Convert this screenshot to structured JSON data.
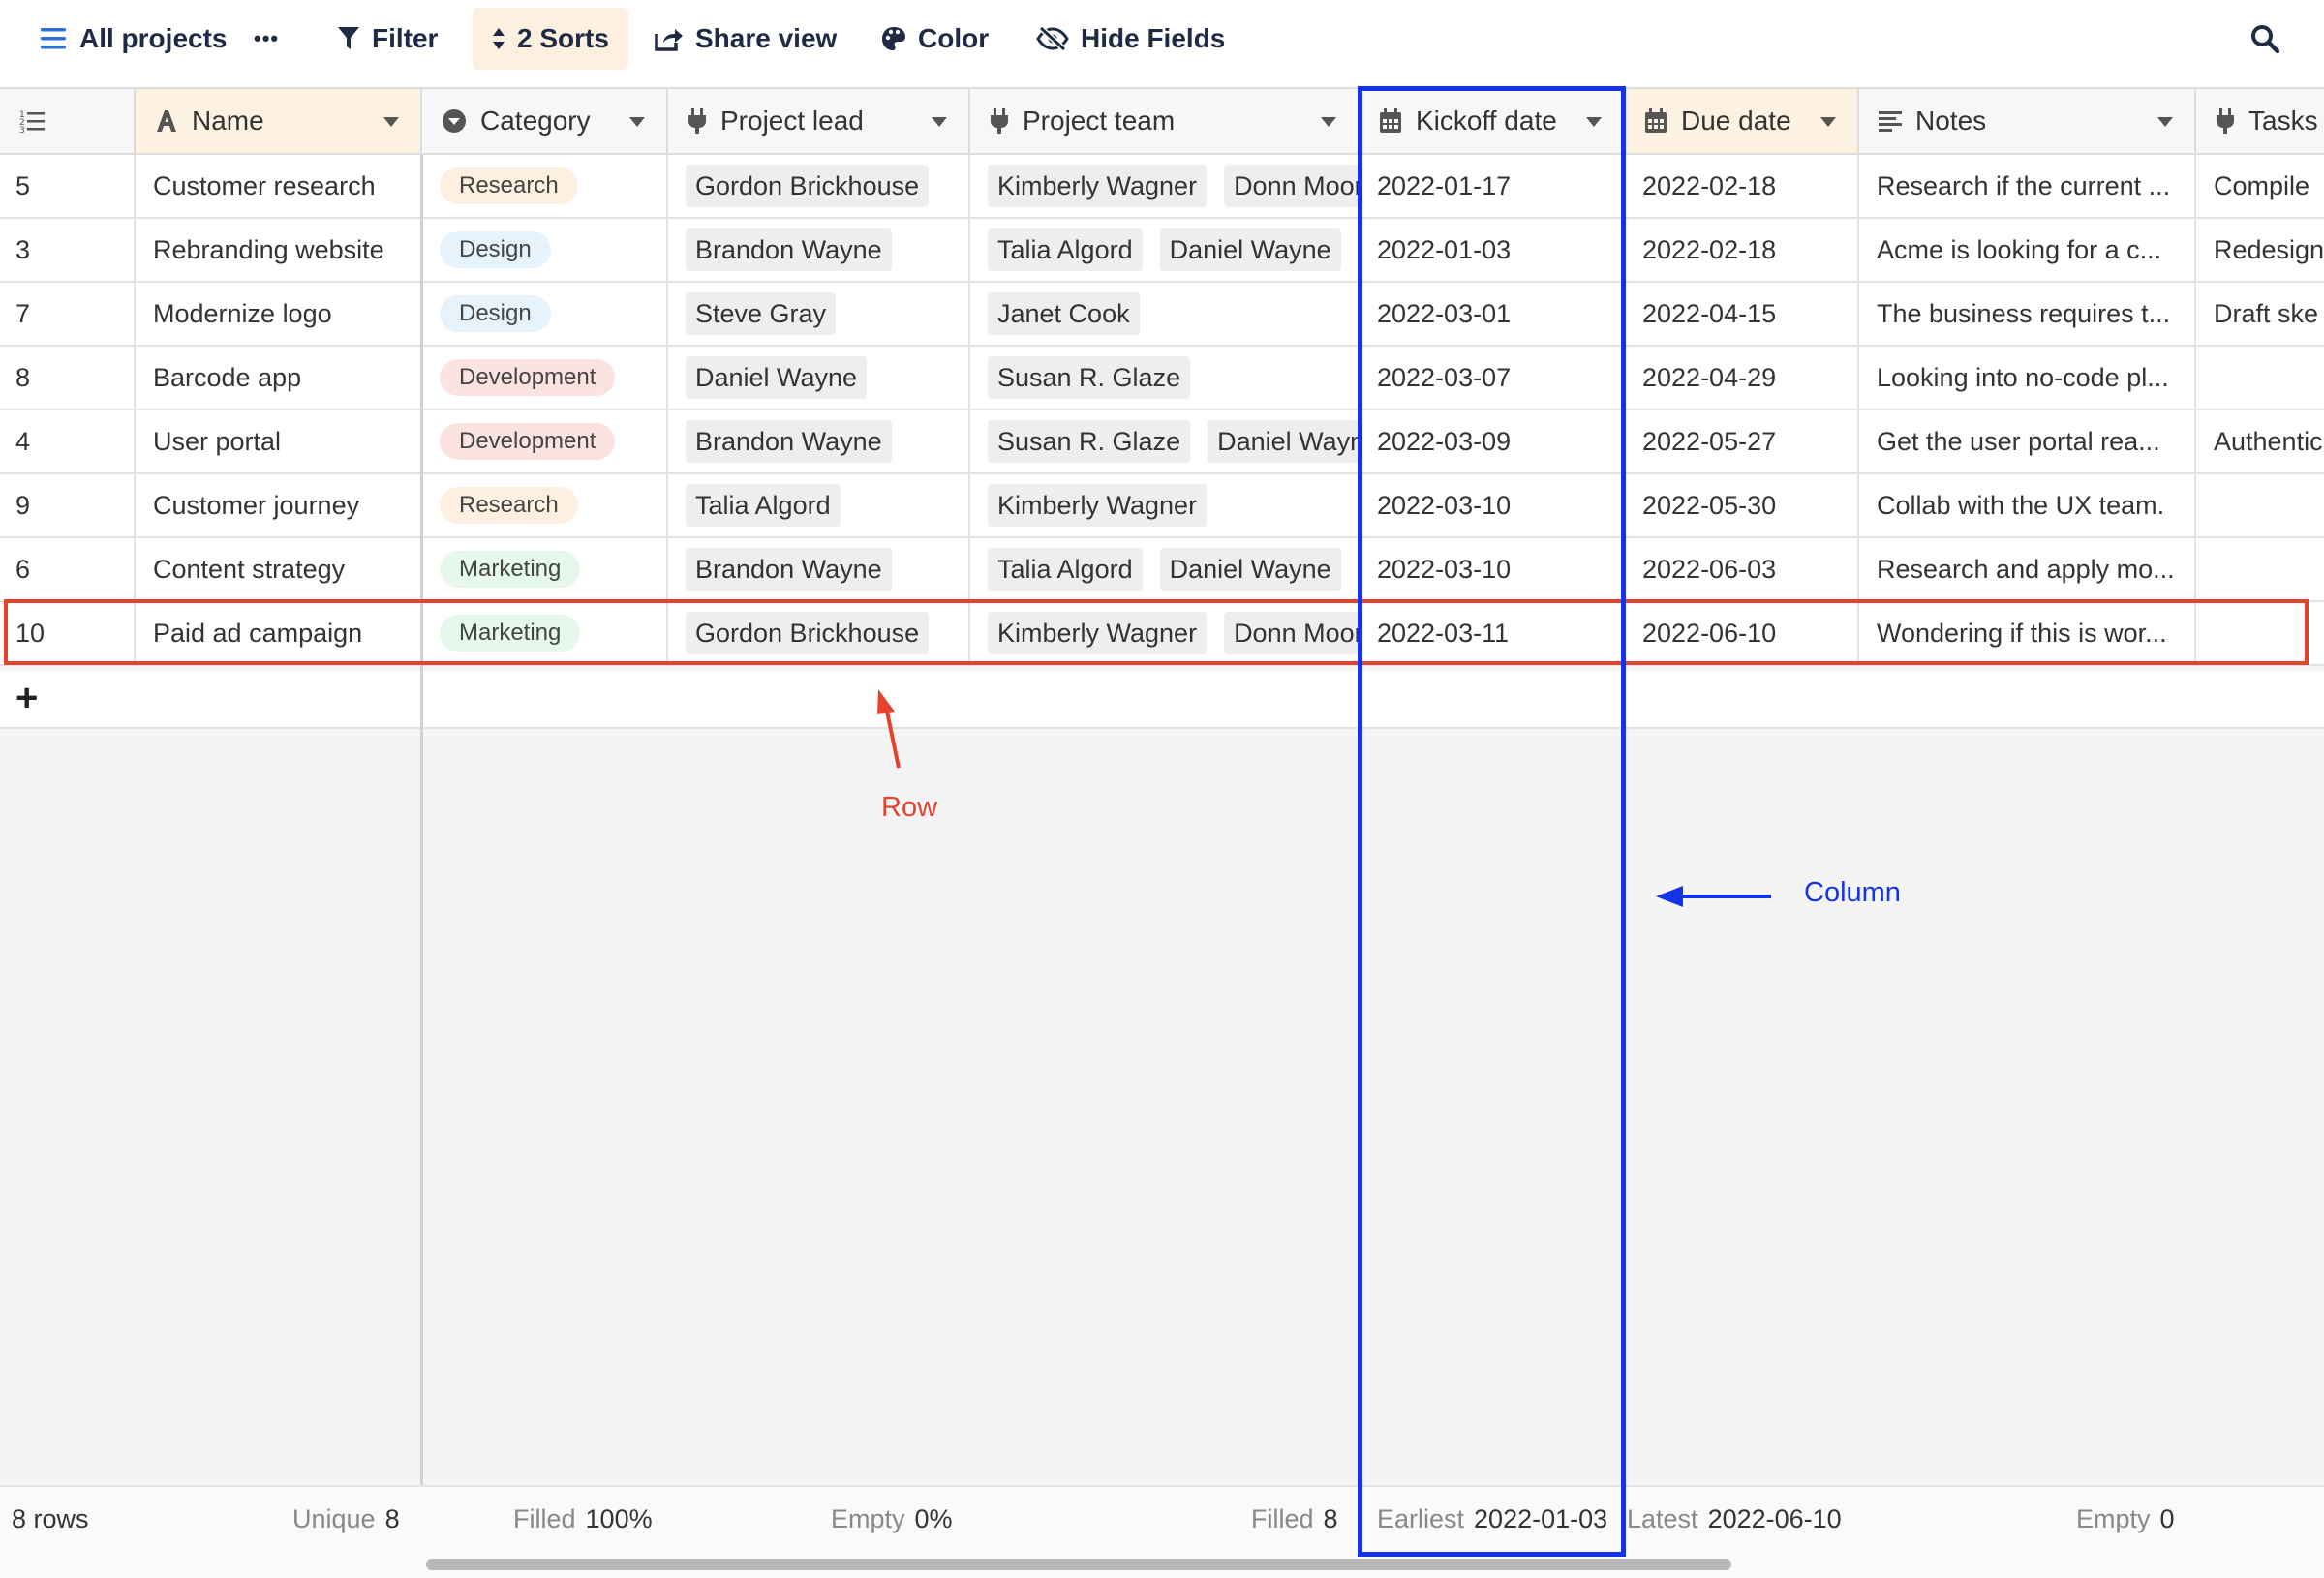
{
  "toolbar": {
    "view_name": "All projects",
    "more": "•••",
    "filter": "Filter",
    "sorts": "2 Sorts",
    "share": "Share view",
    "color": "Color",
    "hide_fields": "Hide Fields",
    "icons": [
      "hamburger-icon",
      "more-icon",
      "filter-icon",
      "sort-icon",
      "share-icon",
      "palette-icon",
      "eye-off-icon",
      "search-icon"
    ]
  },
  "columns": {
    "name": "Name",
    "category": "Category",
    "project_lead": "Project lead",
    "project_team": "Project team",
    "kickoff_date": "Kickoff date",
    "due_date": "Due date",
    "notes": "Notes",
    "tasks": "Tasks"
  },
  "rows": [
    {
      "num": "5",
      "name": "Customer research",
      "category": "Research",
      "lead": "Gordon Brickhouse",
      "team": [
        "Kimberly Wagner",
        "Donn Moore"
      ],
      "kickoff": "2022-01-17",
      "due": "2022-02-18",
      "notes": "Research if the current ...",
      "tasks": "Compile"
    },
    {
      "num": "3",
      "name": "Rebranding website",
      "category": "Design",
      "lead": "Brandon Wayne",
      "team": [
        "Talia Algord",
        "Daniel Wayne"
      ],
      "kickoff": "2022-01-03",
      "due": "2022-02-18",
      "notes": "Acme is looking for a c...",
      "tasks": "Redesign"
    },
    {
      "num": "7",
      "name": "Modernize logo",
      "category": "Design",
      "lead": "Steve Gray",
      "team": [
        "Janet Cook"
      ],
      "kickoff": "2022-03-01",
      "due": "2022-04-15",
      "notes": "The business requires t...",
      "tasks": "Draft ske"
    },
    {
      "num": "8",
      "name": "Barcode app",
      "category": "Development",
      "lead": "Daniel Wayne",
      "team": [
        "Susan R. Glaze"
      ],
      "kickoff": "2022-03-07",
      "due": "2022-04-29",
      "notes": "Looking into no-code pl...",
      "tasks": ""
    },
    {
      "num": "4",
      "name": "User portal",
      "category": "Development",
      "lead": "Brandon Wayne",
      "team": [
        "Susan R. Glaze",
        "Daniel Wayne"
      ],
      "kickoff": "2022-03-09",
      "due": "2022-05-27",
      "notes": "Get the user portal rea...",
      "tasks": "Authentic"
    },
    {
      "num": "9",
      "name": "Customer journey",
      "category": "Research",
      "lead": "Talia Algord",
      "team": [
        "Kimberly Wagner"
      ],
      "kickoff": "2022-03-10",
      "due": "2022-05-30",
      "notes": "Collab with the UX team.",
      "tasks": ""
    },
    {
      "num": "6",
      "name": "Content strategy",
      "category": "Marketing",
      "lead": "Brandon Wayne",
      "team": [
        "Talia Algord",
        "Daniel Wayne"
      ],
      "kickoff": "2022-03-10",
      "due": "2022-06-03",
      "notes": "Research and apply mo...",
      "tasks": ""
    },
    {
      "num": "10",
      "name": "Paid ad campaign",
      "category": "Marketing",
      "lead": "Gordon Brickhouse",
      "team": [
        "Kimberly Wagner",
        "Donn Moore"
      ],
      "kickoff": "2022-03-11",
      "due": "2022-06-10",
      "notes": "Wondering if this is wor...",
      "tasks": ""
    }
  ],
  "category_colors": {
    "Research": {
      "bg": "#fdf0e0",
      "fg": "#444444"
    },
    "Design": {
      "bg": "#e6f3fd",
      "fg": "#444444"
    },
    "Development": {
      "bg": "#fbe3e1",
      "fg": "#444444"
    },
    "Marketing": {
      "bg": "#e6f7eb",
      "fg": "#444444"
    }
  },
  "footer": {
    "rows": "8 rows",
    "unique_label": "Unique",
    "unique_value": "8",
    "filled_label": "Filled",
    "filled_value": "100%",
    "empty_label": "Empty",
    "empty_value": "0%",
    "filled2_label": "Filled",
    "filled2_value": "8",
    "earliest_label": "Earliest",
    "earliest_value": "2022-01-03",
    "latest_label": "Latest",
    "latest_value": "2022-06-10",
    "empty2_label": "Empty",
    "empty2_value": "0"
  },
  "annotations": {
    "row_label": "Row",
    "row_color": "#e5432c",
    "column_label": "Column",
    "column_color": "#1432e6"
  }
}
